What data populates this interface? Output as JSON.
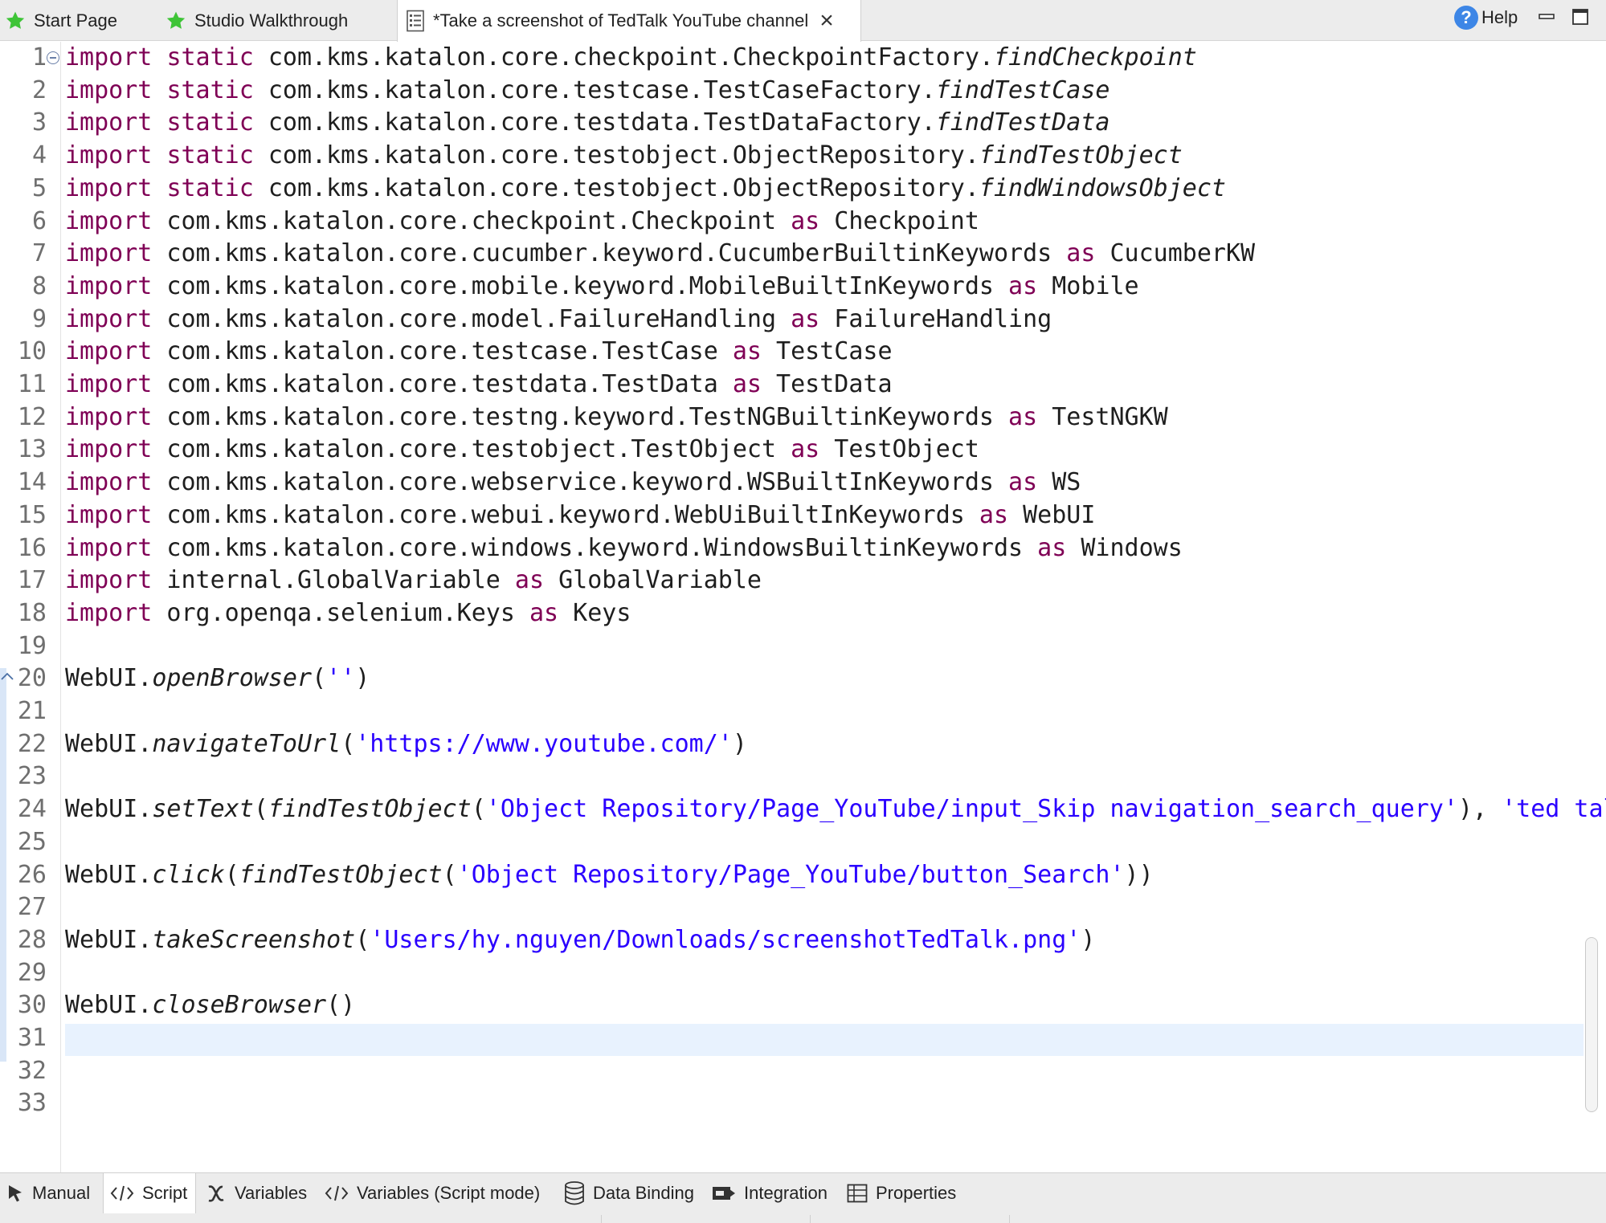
{
  "tabs": [
    {
      "label": "Start Page",
      "icon": "green-star-icon"
    },
    {
      "label": "Studio Walkthrough",
      "icon": "green-star-icon"
    },
    {
      "label": "*Take a screenshot of TedTalk YouTube channel",
      "icon": "test-case-icon",
      "active": true
    }
  ],
  "help": {
    "label": "Help"
  },
  "colors": {
    "keyword": "#7f0055",
    "string": "#2a00ff",
    "line_number": "#6f6f6f",
    "current_line": "#e8f2fe",
    "star": "#3ec437"
  },
  "editor": {
    "current_line": 31,
    "lines": [
      [
        [
          "import",
          "kw"
        ],
        [
          " "
        ],
        [
          "static",
          "kw"
        ],
        [
          " com.kms.katalon.core.checkpoint.CheckpointFactory."
        ],
        [
          "findCheckpoint",
          "it"
        ]
      ],
      [
        [
          "import",
          "kw"
        ],
        [
          " "
        ],
        [
          "static",
          "kw"
        ],
        [
          " com.kms.katalon.core.testcase.TestCaseFactory."
        ],
        [
          "findTestCase",
          "it"
        ]
      ],
      [
        [
          "import",
          "kw"
        ],
        [
          " "
        ],
        [
          "static",
          "kw"
        ],
        [
          " com.kms.katalon.core.testdata.TestDataFactory."
        ],
        [
          "findTestData",
          "it"
        ]
      ],
      [
        [
          "import",
          "kw"
        ],
        [
          " "
        ],
        [
          "static",
          "kw"
        ],
        [
          " com.kms.katalon.core.testobject.ObjectRepository."
        ],
        [
          "findTestObject",
          "it"
        ]
      ],
      [
        [
          "import",
          "kw"
        ],
        [
          " "
        ],
        [
          "static",
          "kw"
        ],
        [
          " com.kms.katalon.core.testobject.ObjectRepository."
        ],
        [
          "findWindowsObject",
          "it"
        ]
      ],
      [
        [
          "import",
          "kw"
        ],
        [
          " com.kms.katalon.core.checkpoint.Checkpoint "
        ],
        [
          "as",
          "kw"
        ],
        [
          " Checkpoint"
        ]
      ],
      [
        [
          "import",
          "kw"
        ],
        [
          " com.kms.katalon.core.cucumber.keyword.CucumberBuiltinKeywords "
        ],
        [
          "as",
          "kw"
        ],
        [
          " CucumberKW"
        ]
      ],
      [
        [
          "import",
          "kw"
        ],
        [
          " com.kms.katalon.core.mobile.keyword.MobileBuiltInKeywords "
        ],
        [
          "as",
          "kw"
        ],
        [
          " Mobile"
        ]
      ],
      [
        [
          "import",
          "kw"
        ],
        [
          " com.kms.katalon.core.model.FailureHandling "
        ],
        [
          "as",
          "kw"
        ],
        [
          " FailureHandling"
        ]
      ],
      [
        [
          "import",
          "kw"
        ],
        [
          " com.kms.katalon.core.testcase.TestCase "
        ],
        [
          "as",
          "kw"
        ],
        [
          " TestCase"
        ]
      ],
      [
        [
          "import",
          "kw"
        ],
        [
          " com.kms.katalon.core.testdata.TestData "
        ],
        [
          "as",
          "kw"
        ],
        [
          " TestData"
        ]
      ],
      [
        [
          "import",
          "kw"
        ],
        [
          " com.kms.katalon.core.testng.keyword.TestNGBuiltinKeywords "
        ],
        [
          "as",
          "kw"
        ],
        [
          " TestNGKW"
        ]
      ],
      [
        [
          "import",
          "kw"
        ],
        [
          " com.kms.katalon.core.testobject.TestObject "
        ],
        [
          "as",
          "kw"
        ],
        [
          " TestObject"
        ]
      ],
      [
        [
          "import",
          "kw"
        ],
        [
          " com.kms.katalon.core.webservice.keyword.WSBuiltInKeywords "
        ],
        [
          "as",
          "kw"
        ],
        [
          " WS"
        ]
      ],
      [
        [
          "import",
          "kw"
        ],
        [
          " com.kms.katalon.core.webui.keyword.WebUiBuiltInKeywords "
        ],
        [
          "as",
          "kw"
        ],
        [
          " WebUI"
        ]
      ],
      [
        [
          "import",
          "kw"
        ],
        [
          " com.kms.katalon.core.windows.keyword.WindowsBuiltinKeywords "
        ],
        [
          "as",
          "kw"
        ],
        [
          " Windows"
        ]
      ],
      [
        [
          "import",
          "kw"
        ],
        [
          " internal.GlobalVariable "
        ],
        [
          "as",
          "kw"
        ],
        [
          " GlobalVariable"
        ]
      ],
      [
        [
          "import",
          "kw"
        ],
        [
          " org.openqa.selenium.Keys "
        ],
        [
          "as",
          "kw"
        ],
        [
          " Keys"
        ]
      ],
      [],
      [
        [
          "WebUI."
        ],
        [
          "openBrowser",
          "it"
        ],
        [
          "("
        ],
        [
          "''",
          "str"
        ],
        [
          ")"
        ]
      ],
      [],
      [
        [
          "WebUI."
        ],
        [
          "navigateToUrl",
          "it"
        ],
        [
          "("
        ],
        [
          "'https://www.youtube.com/'",
          "str"
        ],
        [
          ")"
        ]
      ],
      [],
      [
        [
          "WebUI."
        ],
        [
          "setText",
          "it"
        ],
        [
          "("
        ],
        [
          "findTestObject",
          "it"
        ],
        [
          "("
        ],
        [
          "'Object Repository/Page_YouTube/input_Skip navigation_search_query'",
          "str"
        ],
        [
          "), "
        ],
        [
          "'ted talk",
          "str"
        ]
      ],
      [],
      [
        [
          "WebUI."
        ],
        [
          "click",
          "it"
        ],
        [
          "("
        ],
        [
          "findTestObject",
          "it"
        ],
        [
          "("
        ],
        [
          "'Object Repository/Page_YouTube/button_Search'",
          "str"
        ],
        [
          "))"
        ]
      ],
      [],
      [
        [
          "WebUI."
        ],
        [
          "takeScreenshot",
          "it"
        ],
        [
          "("
        ],
        [
          "'Users/hy.nguyen/Downloads/screenshotTedTalk.png'",
          "str"
        ],
        [
          ")"
        ]
      ],
      [],
      [
        [
          "WebUI."
        ],
        [
          "closeBrowser",
          "it"
        ],
        [
          "()"
        ]
      ],
      [],
      [],
      []
    ]
  },
  "bottom_tabs": [
    {
      "label": "Manual",
      "icon": "cursor-arrow-icon"
    },
    {
      "label": "Script",
      "icon": "code-brackets-icon",
      "active": true
    },
    {
      "label": "Variables",
      "icon": "variable-x-icon"
    },
    {
      "label": "Variables (Script mode)",
      "icon": "code-brackets-icon"
    },
    {
      "label": "Data Binding",
      "icon": "database-icon"
    },
    {
      "label": "Integration",
      "icon": "integration-icon"
    },
    {
      "label": "Properties",
      "icon": "table-icon"
    }
  ]
}
